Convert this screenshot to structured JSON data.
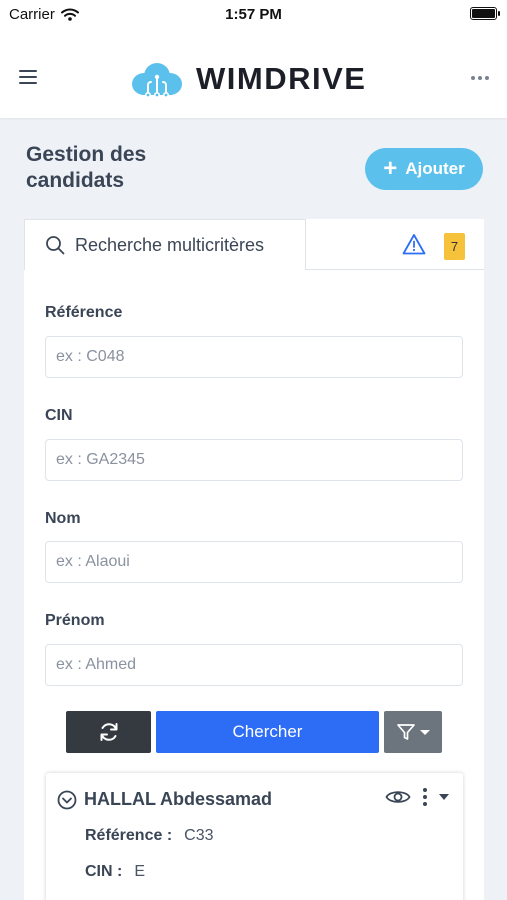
{
  "status_bar": {
    "carrier": "Carrier",
    "time": "1:57 PM"
  },
  "header": {
    "brand": "WIMDRIVE"
  },
  "page": {
    "title": "Gestion des candidats",
    "add_button": "Ajouter"
  },
  "search": {
    "tab_label": "Recherche multicritères",
    "alert_count": "7"
  },
  "fields": [
    {
      "label": "Référence",
      "placeholder": "ex : C048"
    },
    {
      "label": "CIN",
      "placeholder": "ex : GA2345"
    },
    {
      "label": "Nom",
      "placeholder": "ex : Alaoui"
    },
    {
      "label": "Prénom",
      "placeholder": "ex : Ahmed"
    }
  ],
  "actions": {
    "search_label": "Chercher"
  },
  "results": [
    {
      "name": "HALLAL Abdessamad",
      "reference_label": "Référence :",
      "reference": "C33",
      "cin_label": "CIN :",
      "cin": "E"
    }
  ],
  "colors": {
    "accent": "#5bc0eb",
    "primary": "#2d6df6",
    "dark_button": "#343a40",
    "filter_button": "#6c757d",
    "badge": "#f7c23b",
    "warning_icon": "#2d6df6"
  }
}
